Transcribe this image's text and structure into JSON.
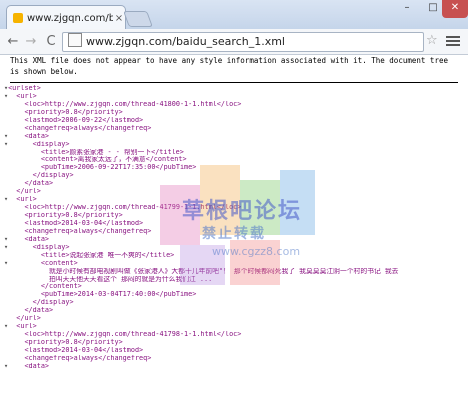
{
  "tab": {
    "title": "www.zjgqn.com/baidu_s",
    "close": "×"
  },
  "window": {
    "minimize": "–",
    "maximize": "□",
    "close": "✕"
  },
  "toolbar": {
    "back": "←",
    "forward": "→",
    "reload": "C",
    "url": "www.zjgqn.com/baidu_search_1.xml",
    "star": "☆"
  },
  "notice": "This XML file does not appear to have any style information associated with it. The document tree is shown below.",
  "watermark": {
    "line1": "草根吧论坛",
    "line2": "禁止转载",
    "line3": "www.cgzz8.com"
  },
  "xml_lines": [
    {
      "toggle": "▾",
      "text": "<urlset>"
    },
    {
      "toggle": "▾",
      "text": "  <url>"
    },
    {
      "toggle": "",
      "text": "    <loc>http://www.zjgqn.com/thread-41800-1-1.html</loc>"
    },
    {
      "toggle": "",
      "text": "    <priority>0.8</priority>"
    },
    {
      "toggle": "",
      "text": "    <lastmod>2006-09-22</lastmod>"
    },
    {
      "toggle": "",
      "text": "    <changefreq>always</changefreq>"
    },
    {
      "toggle": "▾",
      "text": "    <data>"
    },
    {
      "toggle": "▾",
      "text": "      <display>"
    },
    {
      "toggle": "",
      "text": "        <title>颜素张家港 - - 帮别一下</title>"
    },
    {
      "toggle": "",
      "text": "        <content>离我家太远了，不满意</content>"
    },
    {
      "toggle": "",
      "text": "        <pubTime>2006-09-22T17:35:00</pubTime>"
    },
    {
      "toggle": "",
      "text": "      </display>"
    },
    {
      "toggle": "",
      "text": "    </data>"
    },
    {
      "toggle": "",
      "text": "  </url>"
    },
    {
      "toggle": "▾",
      "text": "  <url>"
    },
    {
      "toggle": "",
      "text": "    <loc>http://www.zjgqn.com/thread-41799-1-1.html</loc>"
    },
    {
      "toggle": "",
      "text": "    <priority>0.8</priority>"
    },
    {
      "toggle": "",
      "text": "    <lastmod>2014-03-04</lastmod>"
    },
    {
      "toggle": "",
      "text": "    <changefreq>always</changefreq>"
    },
    {
      "toggle": "▾",
      "text": "    <data>"
    },
    {
      "toggle": "▾",
      "text": "      <display>"
    },
    {
      "toggle": "",
      "text": "        <title>说起张家港 唯一不爽的</title>"
    },
    {
      "toggle": "▾",
      "text": "        <content>"
    },
    {
      "toggle": "",
      "text": "          就是小时候有部电视剧叫做《张家港人》大都十几年前吧\"！ 那个时候都闷死我了 我莫莫莫江阴一个村的书记 我去"
    },
    {
      "toggle": "",
      "text": "          拍叫天天他天天看这个 那闷的就是为什么我们江 ..."
    },
    {
      "toggle": "",
      "text": "        </content>"
    },
    {
      "toggle": "",
      "text": "        <pubTime>2014-03-04T17:40:00</pubTime>"
    },
    {
      "toggle": "",
      "text": "      </display>"
    },
    {
      "toggle": "",
      "text": "    </data>"
    },
    {
      "toggle": "",
      "text": "  </url>"
    },
    {
      "toggle": "▾",
      "text": "  <url>"
    },
    {
      "toggle": "",
      "text": "    <loc>http://www.zjgqn.com/thread-41798-1-1.html</loc>"
    },
    {
      "toggle": "",
      "text": "    <priority>0.8</priority>"
    },
    {
      "toggle": "",
      "text": "    <lastmod>2014-03-04</lastmod>"
    },
    {
      "toggle": "",
      "text": "    <changefreq>always</changefreq>"
    },
    {
      "toggle": "▾",
      "text": "    <data>"
    }
  ]
}
